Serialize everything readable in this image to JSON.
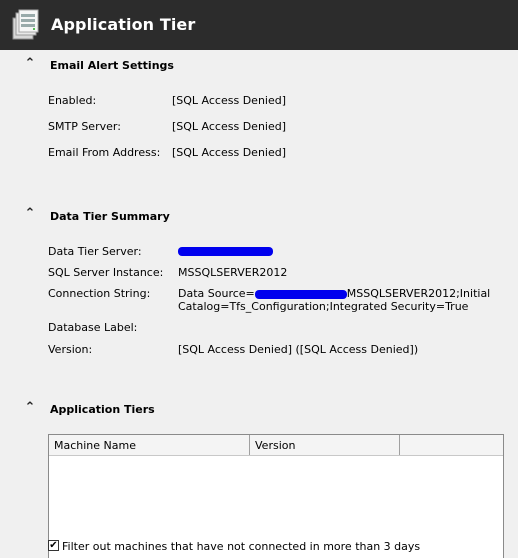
{
  "header": {
    "title": "Application Tier"
  },
  "email": {
    "title": "Email Alert Settings",
    "rows": [
      {
        "label": "Enabled:",
        "value": "[SQL Access Denied]"
      },
      {
        "label": "SMTP Server:",
        "value": "[SQL Access Denied]"
      },
      {
        "label": "Email From Address:",
        "value": "[SQL Access Denied]"
      }
    ]
  },
  "datatier": {
    "title": "Data Tier Summary",
    "server_label": "Data Tier Server:",
    "instance_label": "SQL Server Instance:",
    "instance_value": "MSSQLSERVER2012",
    "conn_label": "Connection String:",
    "conn_prefix": "Data Source=",
    "conn_suffix": "MSSQLSERVER2012;Initial",
    "conn_line2": "Catalog=Tfs_Configuration;Integrated Security=True",
    "dblabel_label": "Database Label:",
    "version_label": "Version:",
    "version_value": "[SQL Access Denied] ([SQL Access Denied])"
  },
  "apptiers": {
    "title": "Application Tiers",
    "columns": [
      "Machine Name",
      "Version",
      ""
    ],
    "filter_label": "Filter out machines that have not connected in more than 3 days",
    "filter_checked": true
  },
  "colors": {
    "header_bg": "#2c2c2c",
    "redaction": "#0000ee"
  }
}
